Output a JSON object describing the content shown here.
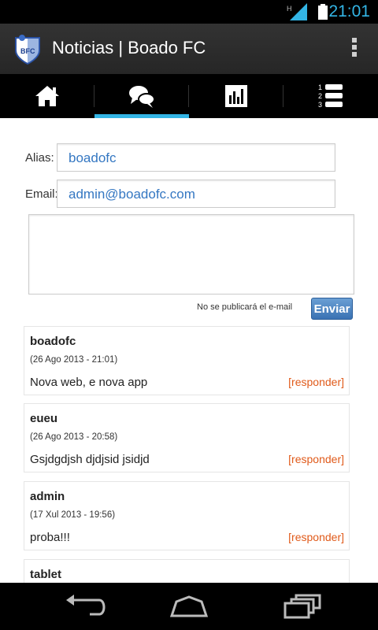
{
  "status_bar": {
    "time": "21:01",
    "signal_label": "H"
  },
  "action_bar": {
    "title": "Noticias | Boado FC",
    "logo_text": "BFC"
  },
  "tabs": [
    {
      "name": "home-icon"
    },
    {
      "name": "chat-icon"
    },
    {
      "name": "bar-chart-icon"
    },
    {
      "name": "ranking-list-icon"
    }
  ],
  "form": {
    "alias_label": "Alias:",
    "alias_value": "boadofc",
    "email_label": "Email:",
    "email_value": "admin@boadofc.com",
    "notice": "No se publicará el e-mail",
    "send_label": "Enviar"
  },
  "comments": [
    {
      "author": "boadofc",
      "date": "(26 Ago 2013 - 21:01)",
      "message": "Nova web, e nova app",
      "reply": "[responder]"
    },
    {
      "author": "eueu",
      "date": "(26 Ago 2013 - 20:58)",
      "message": "Gsjdgdjsh djdjsid jsidjd",
      "reply": "[responder]"
    },
    {
      "author": "admin",
      "date": "(17 Xul 2013 - 19:56)",
      "message": "proba!!!",
      "reply": "[responder]"
    },
    {
      "author": "tablet",
      "date": "",
      "message": "",
      "reply": ""
    }
  ],
  "colors": {
    "accent": "#33b5e5",
    "link": "#3477c2",
    "reply": "#e05a1a",
    "button": "#3a72b3"
  }
}
